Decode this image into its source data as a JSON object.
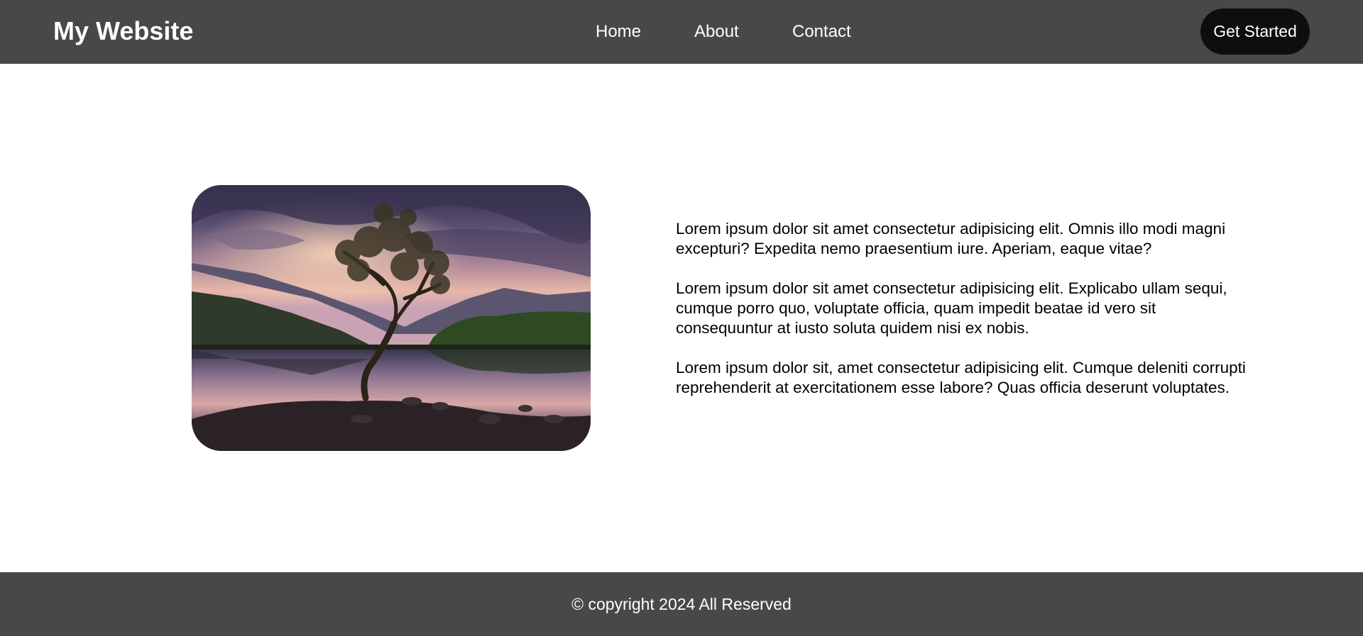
{
  "header": {
    "brand": "My Website",
    "nav": {
      "home": "Home",
      "about": "About",
      "contact": "Contact"
    },
    "cta_label": "Get Started"
  },
  "main": {
    "paragraphs": [
      "Lorem ipsum dolor sit amet consectetur adipisicing elit. Omnis illo modi magni excepturi? Expedita nemo praesentium iure. Aperiam, eaque vitae?",
      "Lorem ipsum dolor sit amet consectetur adipisicing elit. Explicabo ullam sequi, cumque porro quo, voluptate officia, quam impedit beatae id vero sit consequuntur at iusto soluta quidem nisi ex nobis.",
      "Lorem ipsum dolor sit, amet consectetur adipisicing elit. Cumque deleniti corrupti reprehenderit at exercitationem esse labore? Quas officia deserunt voluptates."
    ]
  },
  "footer": {
    "copyright": "© copyright 2024 All Reserved"
  },
  "colors": {
    "header_bg": "#484848",
    "footer_bg": "#484848",
    "cta_bg": "#0e0e0e",
    "text_light": "#ffffff"
  }
}
